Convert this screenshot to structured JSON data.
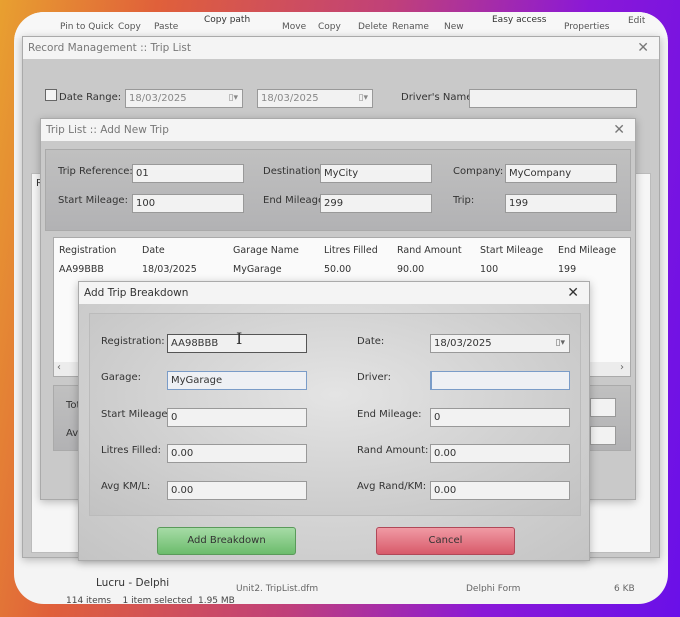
{
  "explorer": {
    "ribbon": [
      "Pin to Quick",
      "Copy",
      "Paste",
      "Copy path",
      "Move",
      "Copy",
      "Delete",
      "Rename",
      "New",
      "Easy access",
      "Properties",
      "Edit"
    ],
    "folder": "Lucru - Delphi",
    "file_partial": "Unit2. TripList.dfm",
    "type_partial": "Delphi Form",
    "size_partial": "6 KB",
    "status": "114 items    1 item selected  1.95 MB"
  },
  "record_window": {
    "title": "Record Management :: Trip List",
    "date_range_label": "Date Range:",
    "date_from": "18/03/2025",
    "date_to": "18/03/2025",
    "drivers_name_label": "Driver's Name:",
    "drivers_name_value": "",
    "partial_label": "R"
  },
  "trip_window": {
    "title": "Trip List :: Add New Trip",
    "fields": {
      "trip_reference_label": "Trip Reference:",
      "trip_reference": "01",
      "destination_label": "Destination:",
      "destination": "MyCity",
      "company_label": "Company:",
      "company": "MyCompany",
      "start_mileage_label": "Start Mileage:",
      "start_mileage": "100",
      "end_mileage_label": "End Mileage:",
      "end_mileage": "299",
      "trip_label": "Trip:",
      "trip": "199"
    },
    "grid": {
      "columns": [
        "Registration",
        "Date",
        "Garage Name",
        "Litres Filled",
        "Rand Amount",
        "Start Mileage",
        "End Mileage"
      ],
      "rows": [
        [
          "AA99BBB",
          "18/03/2025",
          "MyGarage",
          "50.00",
          "90.00",
          "100",
          "199"
        ]
      ]
    },
    "totals_labels": [
      "Tot",
      "Av"
    ]
  },
  "breakdown_dialog": {
    "title": "Add Trip Breakdown",
    "registration_label": "Registration:",
    "registration": "AA98BBB",
    "date_label": "Date:",
    "date": "18/03/2025",
    "garage_label": "Garage:",
    "garage": "MyGarage",
    "driver_label": "Driver:",
    "driver": "",
    "start_mileage_label": "Start Mileage:",
    "start_mileage": "0",
    "end_mileage_label": "End Mileage:",
    "end_mileage": "0",
    "litres_label": "Litres Filled:",
    "litres": "0.00",
    "rand_label": "Rand Amount:",
    "rand": "0.00",
    "avg_kml_label": "Avg KM/L:",
    "avg_kml": "0.00",
    "avg_rand_label": "Avg Rand/KM:",
    "avg_rand": "0.00",
    "add_button": "Add Breakdown",
    "cancel_button": "Cancel"
  },
  "colors": {
    "add": "#7cc47c",
    "cancel": "#e06070"
  }
}
